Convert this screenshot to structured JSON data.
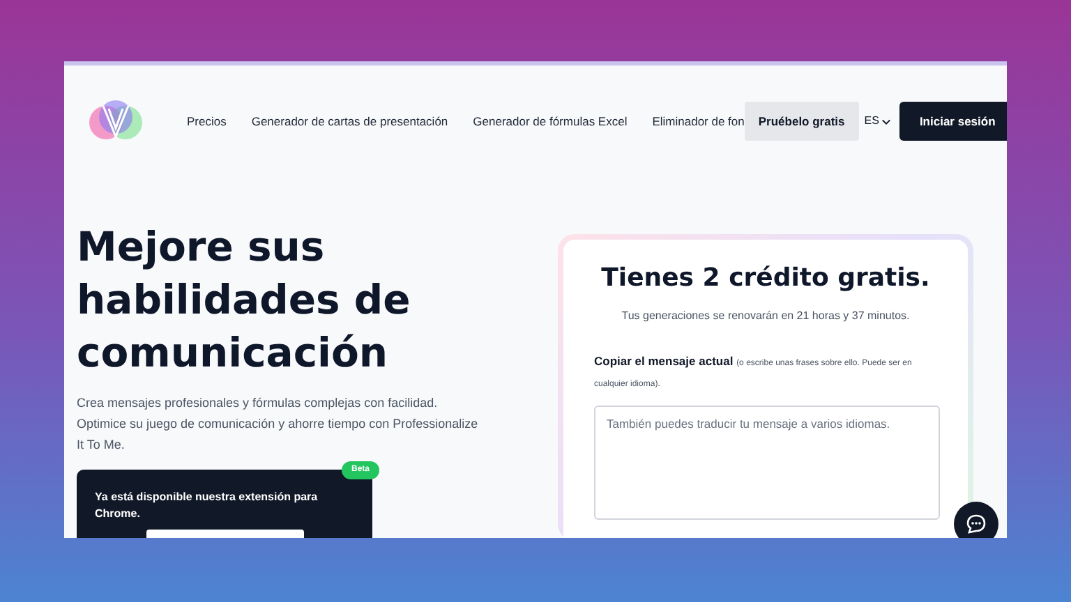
{
  "nav": {
    "links": [
      "Precios",
      "Generador de cartas de presentación",
      "Generador de fórmulas Excel",
      "Eliminador de fon"
    ],
    "try_button": "Pruébelo gratis",
    "language": "ES",
    "login_button": "Iniciar sesión"
  },
  "hero": {
    "title_lines": [
      "Mejore sus",
      "habilidades de",
      "comunicación"
    ],
    "description": "Crea mensajes profesionales y fórmulas complejas con facilidad. Optimice su juego de comunicación y ahorre tiempo con Professionalize It To Me.",
    "extension_card": {
      "badge": "Beta",
      "text": "Ya está disponible nuestra extensión para Chrome."
    }
  },
  "credits_card": {
    "title": "Tienes 2 crédito gratis.",
    "subtitle": "Tus generaciones se renovarán en 21 horas y 37 minutos.",
    "field_label": "Copiar el mensaje actual",
    "field_hint": "(o escribe unas frases sobre ello. Puede ser en cualquier idioma).",
    "placeholder": "También puedes traducir tu mensaje a varios idiomas."
  }
}
